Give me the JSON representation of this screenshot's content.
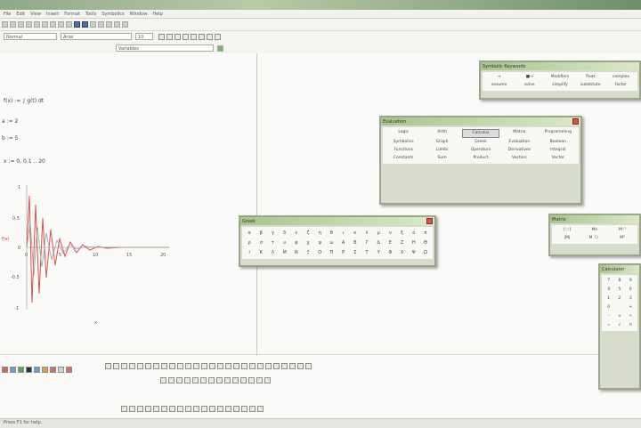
{
  "menubar": {
    "items": [
      "File",
      "Edit",
      "View",
      "Insert",
      "Format",
      "Tools",
      "Symbolics",
      "Window",
      "Help"
    ]
  },
  "format_bar": {
    "style_value": "Normal",
    "font_value": "Arial",
    "size_value": "10"
  },
  "region_bar": {
    "region_value": "Variables"
  },
  "worksheet": {
    "line1": "f(x) := ∫ g(t) dt",
    "line2": "a := 2",
    "line3": "b := 5",
    "line4": "x := 0, 0.1 .. 20"
  },
  "plot": {
    "yticks": [
      "1",
      "0.5",
      "0",
      "-0.5",
      "-1"
    ],
    "xticks": [
      "0",
      "5",
      "10",
      "15",
      "20"
    ],
    "ylabel": "f(x)",
    "xlabel": "x"
  },
  "panels": {
    "symbolic": {
      "title": "Symbolic Keywords",
      "items": [
        "→",
        "■→",
        "Modifiers",
        "float",
        "complex",
        "assume",
        "solve",
        "simplify",
        "substitute",
        "factor"
      ]
    },
    "evaluation": {
      "title": "Evaluation",
      "items": [
        "Logic",
        "Arith",
        "Calculus",
        "Matrix",
        "Programming",
        "Symbolics",
        "Graph",
        "Greek",
        "Evaluation",
        "Boolean",
        "Functions",
        "Limits",
        "Operators",
        "Derivatives",
        "Integral",
        "Constants",
        "Sum",
        "Product",
        "Vectors",
        "Vector"
      ]
    },
    "greek": {
      "title": "Greek",
      "items": [
        "α",
        "β",
        "γ",
        "δ",
        "ε",
        "ζ",
        "η",
        "θ",
        "ι",
        "κ",
        "λ",
        "μ",
        "ν",
        "ξ",
        "ο",
        "π",
        "ρ",
        "σ",
        "τ",
        "υ",
        "φ",
        "χ",
        "ψ",
        "ω",
        "Α",
        "Β",
        "Γ",
        "Δ",
        "Ε",
        "Ζ",
        "Η",
        "Θ",
        "Ι",
        "Κ",
        "Λ",
        "Μ",
        "Ν",
        "Ξ",
        "Ο",
        "Π",
        "Ρ",
        "Σ",
        "Τ",
        "Υ",
        "Φ",
        "Χ",
        "Ψ",
        "Ω"
      ]
    },
    "matrix": {
      "title": "Matrix",
      "items": [
        "[:::]",
        "Mn",
        "M⁻¹",
        "|M|",
        "M〈〉",
        "Mᵀ"
      ]
    },
    "calculator": {
      "title": "Calculator",
      "items": [
        "7",
        "8",
        "9",
        "4",
        "5",
        "6",
        "1",
        "2",
        "3",
        "0",
        ".",
        "+",
        "-",
        "×",
        "÷",
        "=",
        "√",
        "π"
      ]
    }
  },
  "status": {
    "text": "Press F1 for help."
  }
}
